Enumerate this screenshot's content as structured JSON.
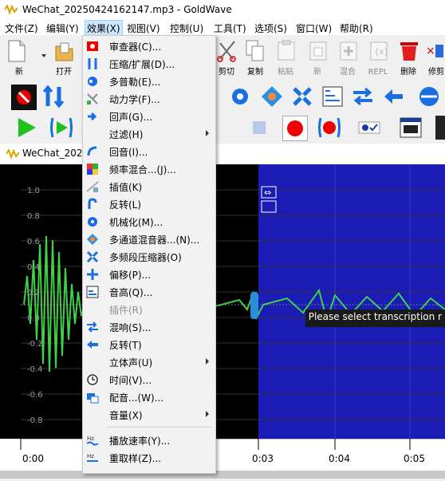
{
  "window": {
    "title": "WeChat_20250424162147.mp3 - GoldWave"
  },
  "menubar": [
    {
      "label": "文件(Z)"
    },
    {
      "label": "编辑(Y)"
    },
    {
      "label": "效果(X)"
    },
    {
      "label": "视图(V)"
    },
    {
      "label": "控制(U)"
    },
    {
      "label": "工具(T)"
    },
    {
      "label": "选项(S)"
    },
    {
      "label": "窗口(W)"
    },
    {
      "label": "帮助(R)"
    }
  ],
  "toolbar": {
    "new": "新",
    "open": "打开",
    "cut": "剪切",
    "copy": "复制",
    "paste": "粘贴",
    "paste_new": "新",
    "mix": "混合",
    "replace": "REPL",
    "delete": "删除",
    "trim": "修剪"
  },
  "document": {
    "title": "WeChat_2025",
    "notice": "Please select transcription r",
    "y_labels": [
      "1.0",
      "0.8",
      "0.6",
      "0.4",
      "0.2",
      "0.0",
      "-0.2",
      "-0.4",
      "-0.6",
      "-0.8"
    ],
    "time_labels": [
      "0:00",
      "0:03",
      "0:04",
      "0:05"
    ]
  },
  "effects_menu": {
    "items": [
      {
        "label": "审查器(C)...",
        "icon": "inspector-icon",
        "disabled": false,
        "submenu": false
      },
      {
        "label": "压缩/扩展(D)...",
        "icon": "compress-expand-icon",
        "disabled": false,
        "submenu": false
      },
      {
        "label": "多普勒(E)...",
        "icon": "doppler-icon",
        "disabled": false,
        "submenu": false
      },
      {
        "label": "动力学(F)...",
        "icon": "dynamics-icon",
        "disabled": false,
        "submenu": false
      },
      {
        "label": "回声(G)...",
        "icon": "echo-icon",
        "disabled": false,
        "submenu": false
      },
      {
        "label": "过滤(H)",
        "icon": "",
        "disabled": false,
        "submenu": true
      },
      {
        "label": "回音(I)...",
        "icon": "reverb-icon",
        "disabled": false,
        "submenu": false
      },
      {
        "label": "频率混合...(J)...",
        "icon": "frequency-mix-icon",
        "disabled": false,
        "submenu": false
      },
      {
        "label": "插值(K)",
        "icon": "interpolate-icon",
        "disabled": false,
        "submenu": false
      },
      {
        "label": "反转(L)",
        "icon": "invert-icon",
        "disabled": false,
        "submenu": false
      },
      {
        "label": "机械化(M)...",
        "icon": "mechanize-icon",
        "disabled": false,
        "submenu": false
      },
      {
        "label": "多通道混音器...(N)...",
        "icon": "multichannel-mixer-icon",
        "disabled": false,
        "submenu": false
      },
      {
        "label": "多频段压缩器(O)",
        "icon": "multiband-compressor-icon",
        "disabled": false,
        "submenu": false
      },
      {
        "label": "偏移(P)...",
        "icon": "offset-icon",
        "disabled": false,
        "submenu": false
      },
      {
        "label": "音高(Q)...",
        "icon": "pitch-icon",
        "disabled": false,
        "submenu": false
      },
      {
        "label": "插件(R)",
        "icon": "",
        "disabled": true,
        "submenu": false
      },
      {
        "label": "混响(S)...",
        "icon": "reverb-mix-icon",
        "disabled": false,
        "submenu": false
      },
      {
        "label": "反转(T)",
        "icon": "reverse-icon",
        "disabled": false,
        "submenu": false
      },
      {
        "label": "立体声(U)",
        "icon": "",
        "disabled": false,
        "submenu": true
      },
      {
        "label": "时间(V)...",
        "icon": "time-icon",
        "disabled": false,
        "submenu": false
      },
      {
        "label": "配音...(W)...",
        "icon": "voice-over-icon",
        "disabled": false,
        "submenu": false
      },
      {
        "label": "音量(X)",
        "icon": "",
        "disabled": false,
        "submenu": true
      },
      {
        "label": "播放速率(Y)...",
        "icon": "playback-rate-icon",
        "disabled": false,
        "submenu": false
      },
      {
        "label": "重取样(Z)...",
        "icon": "resample-icon",
        "disabled": false,
        "submenu": false
      }
    ]
  },
  "colors": {
    "selection_blue": "#1b1bb5",
    "waveform_green": "#3fd14a",
    "menu_bg": "#f2f2f2"
  }
}
